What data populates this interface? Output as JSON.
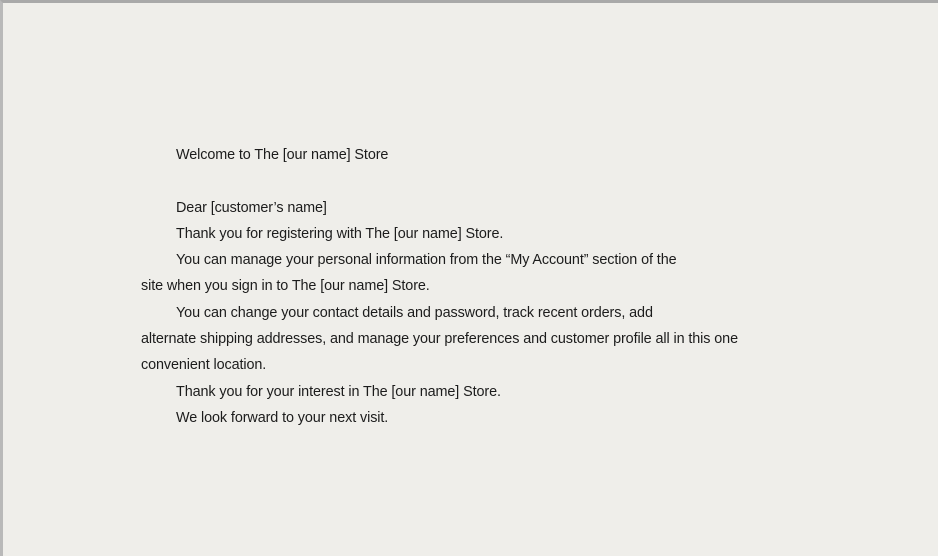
{
  "letter": {
    "heading": "Welcome to The [our name] Store",
    "salutation": "Dear [customer’s name]",
    "lines": [
      "Thank you for registering with The [our name] Store.",
      "You can manage your personal information from the “My Account” section of the",
      "site when you sign in to The [our name] Store.",
      "You can change your contact details and password, track recent orders, add",
      "alternate shipping addresses, and manage your preferences and customer profile all in this one",
      "convenient location.",
      "Thank you for your interest in The [our name] Store.",
      "We look forward to your next visit."
    ]
  }
}
